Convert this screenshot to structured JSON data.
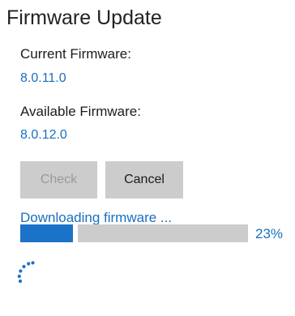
{
  "title": "Firmware Update",
  "current_firmware": {
    "label": "Current Firmware:",
    "value": "8.0.11.0"
  },
  "available_firmware": {
    "label": "Available Firmware:",
    "value": "8.0.12.0"
  },
  "buttons": {
    "check_label": "Check",
    "check_enabled": false,
    "cancel_label": "Cancel"
  },
  "status_text": "Downloading firmware ...",
  "progress": {
    "fraction": 0.23,
    "percent_label": "23%"
  },
  "colors": {
    "accent": "#1a73c8",
    "track": "#cccccc",
    "button_bg": "#cccccc",
    "disabled_text": "#9a9a9a"
  },
  "icons": {
    "spinner": "loading-spinner-icon"
  }
}
